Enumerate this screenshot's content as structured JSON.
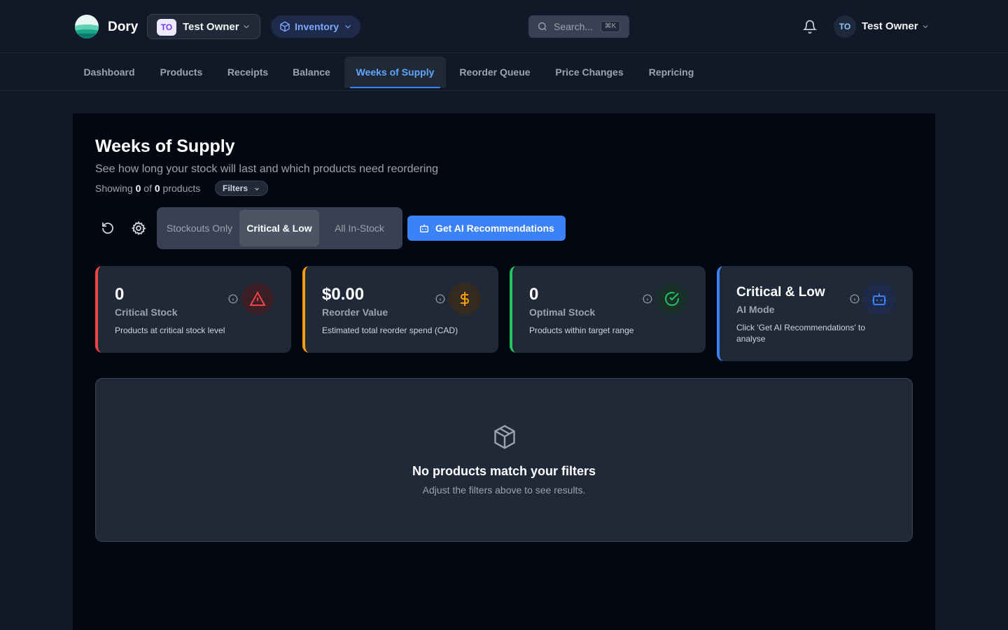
{
  "brand": {
    "name": "Dory"
  },
  "org_selector": {
    "initials": "TO",
    "name": "Test Owner"
  },
  "module": {
    "label": "Inventory"
  },
  "search": {
    "placeholder": "Search...",
    "shortcut": "⌘K"
  },
  "user": {
    "initials": "TO",
    "name": "Test Owner"
  },
  "nav": {
    "tabs": [
      {
        "label": "Dashboard"
      },
      {
        "label": "Products"
      },
      {
        "label": "Receipts"
      },
      {
        "label": "Balance"
      },
      {
        "label": "Weeks of Supply",
        "active": true
      },
      {
        "label": "Reorder Queue"
      },
      {
        "label": "Price Changes"
      },
      {
        "label": "Repricing"
      }
    ]
  },
  "page": {
    "title": "Weeks of Supply",
    "subtitle": "See how long your stock will last and which products need reordering",
    "showing_prefix": "Showing",
    "showing_count": "0",
    "showing_of": "of",
    "showing_total": "0",
    "showing_suffix": "products",
    "filters_label": "Filters"
  },
  "toolbar": {
    "segments": [
      {
        "label": "Stockouts Only"
      },
      {
        "label": "Critical & Low",
        "active": true
      },
      {
        "label": "All In-Stock"
      }
    ],
    "ai_button_label": "Get AI Recommendations"
  },
  "cards": [
    {
      "value": "0",
      "label": "Critical Stock",
      "desc": "Products at critical stock level",
      "accent": "#ef4444",
      "icon": "alert-triangle-icon"
    },
    {
      "value": "$0.00",
      "label": "Reorder Value",
      "desc": "Estimated total reorder spend (CAD)",
      "accent": "#f59e0b",
      "icon": "dollar-icon"
    },
    {
      "value": "0",
      "label": "Optimal Stock",
      "desc": "Products within target range",
      "accent": "#22c55e",
      "icon": "check-circle-icon"
    },
    {
      "value": "Critical & Low",
      "label": "AI Mode",
      "desc": "Click 'Get AI Recommendations' to analyse",
      "accent": "#3b82f6",
      "icon": "bot-icon"
    }
  ],
  "empty_state": {
    "icon": "package-icon",
    "title": "No products match your filters",
    "message": "Adjust the filters above to see results."
  },
  "colors": {
    "accent": "#3b82f6",
    "background": "#111827",
    "panel": "#030712",
    "card": "#1f2937"
  }
}
